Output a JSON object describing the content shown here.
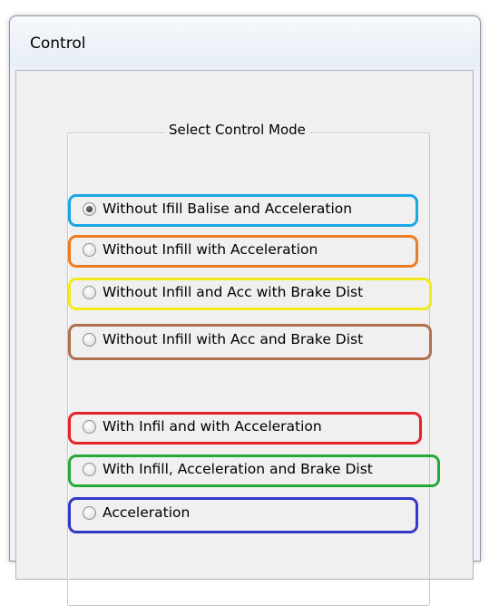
{
  "window": {
    "title": "Control"
  },
  "group": {
    "title": "Select Control Mode"
  },
  "options": [
    {
      "label": "Without Ifill Balise and Acceleration",
      "checked": true,
      "highlight": "#1ba6e6"
    },
    {
      "label": "Without Infill with Acceleration",
      "checked": false,
      "highlight": "#f07a1e"
    },
    {
      "label": "Without Infill and Acc with Brake Dist",
      "checked": false,
      "highlight": "#f2ea1a"
    },
    {
      "label": "Without Infill with Acc and Brake Dist",
      "checked": false,
      "highlight": "#b07050"
    },
    {
      "label": "With Infil and with Acceleration",
      "checked": false,
      "highlight": "#e5212a"
    },
    {
      "label": "With Infill, Acceleration and Brake Dist",
      "checked": false,
      "highlight": "#25a83c"
    },
    {
      "label": "Acceleration",
      "checked": false,
      "highlight": "#3438c8"
    }
  ]
}
